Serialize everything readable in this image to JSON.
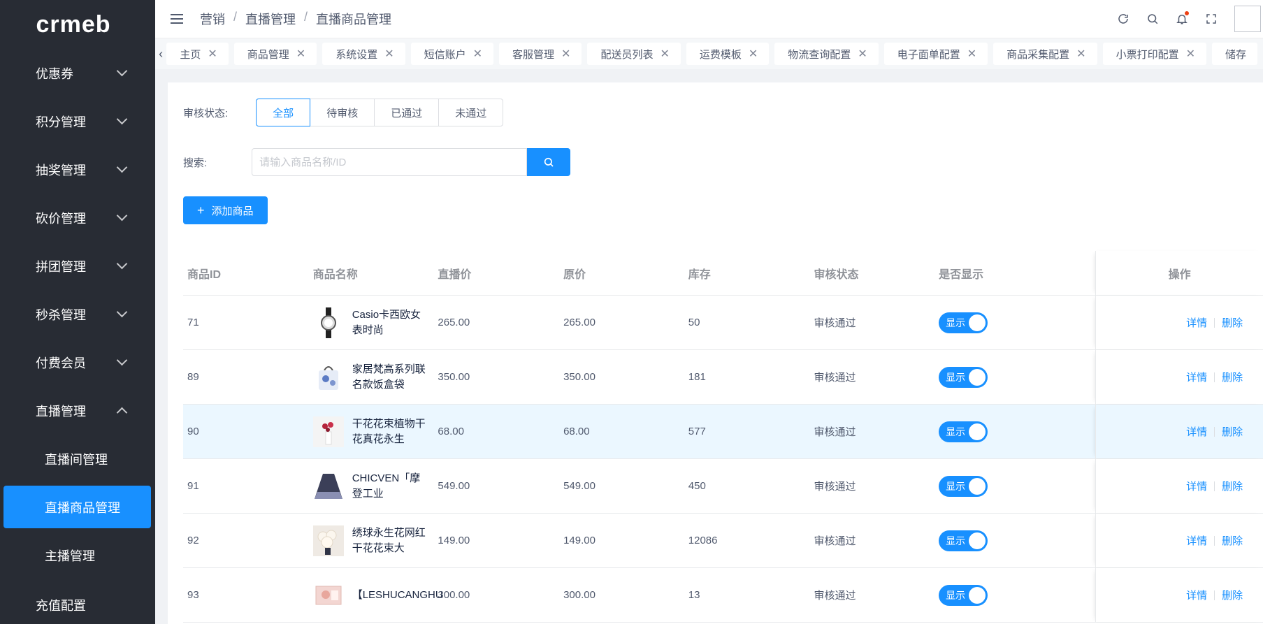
{
  "sidebar": {
    "logo": "crmeb",
    "items": [
      {
        "label": "优惠券",
        "expanded": false
      },
      {
        "label": "积分管理",
        "expanded": false
      },
      {
        "label": "抽奖管理",
        "expanded": false
      },
      {
        "label": "砍价管理",
        "expanded": false
      },
      {
        "label": "拼团管理",
        "expanded": false
      },
      {
        "label": "秒杀管理",
        "expanded": false
      },
      {
        "label": "付费会员",
        "expanded": false
      },
      {
        "label": "直播管理",
        "expanded": true
      }
    ],
    "sub_items": [
      {
        "label": "直播间管理",
        "active": false
      },
      {
        "label": "直播商品管理",
        "active": true
      },
      {
        "label": "主播管理",
        "active": false
      }
    ],
    "bottom_item": "充值配置"
  },
  "header": {
    "breadcrumb": [
      "营销",
      "直播管理",
      "直播商品管理"
    ],
    "icons": [
      "refresh-icon",
      "search-icon",
      "bell-icon",
      "fullscreen-icon"
    ]
  },
  "tabs": [
    "主页",
    "商品管理",
    "系统设置",
    "短信账户",
    "客服管理",
    "配送员列表",
    "运费模板",
    "物流查询配置",
    "电子面单配置",
    "商品采集配置",
    "小票打印配置",
    "储存"
  ],
  "filters": {
    "status_label": "审核状态:",
    "status_options": [
      "全部",
      "待审核",
      "已通过",
      "未通过"
    ],
    "status_selected": "全部",
    "search_label": "搜索:",
    "search_placeholder": "请输入商品名称/ID",
    "search_value": ""
  },
  "add_button": "添加商品",
  "table": {
    "headers": [
      "商品ID",
      "商品名称",
      "直播价",
      "原价",
      "库存",
      "审核状态",
      "是否显示",
      "操作"
    ],
    "rows": [
      {
        "id": "71",
        "name": "Casio卡西欧女表时尚",
        "live_price": "265.00",
        "orig_price": "265.00",
        "stock": "50",
        "audit": "审核通过",
        "show": "显示",
        "thumb": "watch"
      },
      {
        "id": "89",
        "name": "家居梵高系列联名款饭盒袋",
        "live_price": "350.00",
        "orig_price": "350.00",
        "stock": "181",
        "audit": "审核通过",
        "show": "显示",
        "thumb": "bag"
      },
      {
        "id": "90",
        "name": "干花花束植物干花真花永生",
        "live_price": "68.00",
        "orig_price": "68.00",
        "stock": "577",
        "audit": "审核通过",
        "show": "显示",
        "thumb": "flower"
      },
      {
        "id": "91",
        "name": "CHICVEN「摩登工业",
        "live_price": "549.00",
        "orig_price": "549.00",
        "stock": "450",
        "audit": "审核通过",
        "show": "显示",
        "thumb": "skirt"
      },
      {
        "id": "92",
        "name": "绣球永生花网红干花花束大",
        "live_price": "149.00",
        "orig_price": "149.00",
        "stock": "12086",
        "audit": "审核通过",
        "show": "显示",
        "thumb": "bouquet"
      },
      {
        "id": "93",
        "name": "【LESHUCANGHU",
        "live_price": "300.00",
        "orig_price": "300.00",
        "stock": "13",
        "audit": "审核通过",
        "show": "显示",
        "thumb": "card"
      }
    ],
    "op_detail": "详情",
    "op_delete": "删除"
  },
  "colors": {
    "primary": "#1890ff",
    "sidebar_bg": "#282c34",
    "hover_row": "#ebf7ff"
  }
}
